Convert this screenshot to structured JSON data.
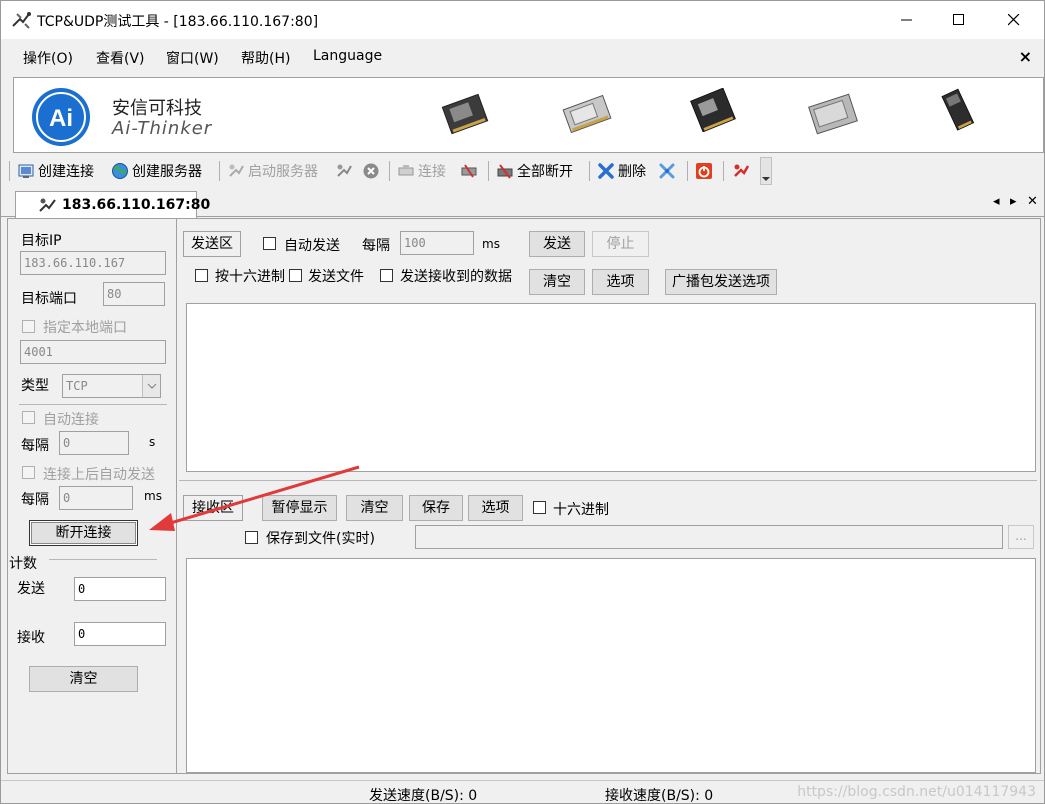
{
  "window": {
    "title": "TCP&UDP测试工具 - [183.66.110.167:80]"
  },
  "menu": {
    "items": [
      "操作(O)",
      "查看(V)",
      "窗口(W)",
      "帮助(H)",
      "Language"
    ],
    "close": "×"
  },
  "banner": {
    "brand_cn": "安信可科技",
    "brand_en": "Ai-Thinker",
    "logo_text": "Ai"
  },
  "toolbar": {
    "create_connection": "创建连接",
    "create_server": "创建服务器",
    "start_server": "启动服务器",
    "connect": "连接",
    "disconnect_all": "全部断开",
    "delete": "删除"
  },
  "tab": {
    "label": "183.66.110.167:80"
  },
  "left_panel": {
    "target_ip_label": "目标IP",
    "target_ip_value": "183.66.110.167",
    "target_port_label": "目标端口",
    "target_port_value": "80",
    "local_port_label": "指定本地端口",
    "local_port_value": "4001",
    "type_label": "类型",
    "type_value": "TCP",
    "auto_connect_label": "自动连接",
    "interval_label": "每隔",
    "interval1_value": "0",
    "interval1_unit": "s",
    "auto_send_after_connect_label": "连接上后自动发送",
    "interval2_value": "0",
    "interval2_unit": "ms",
    "disconnect_button": "断开连接",
    "count_label": "计数",
    "send_label": "发送",
    "send_value": "0",
    "recv_label": "接收",
    "recv_value": "0",
    "clear_button": "清空"
  },
  "send_area": {
    "title": "发送区",
    "auto_send_label": "自动发送",
    "interval_label": "每隔",
    "interval_value": "100",
    "interval_unit": "ms",
    "send_button": "发送",
    "stop_button": "停止",
    "hex_label": "按十六进制",
    "send_file_label": "发送文件",
    "send_received_label": "发送接收到的数据",
    "clear_button": "清空",
    "options_button": "选项",
    "broadcast_button": "广播包发送选项"
  },
  "recv_area": {
    "title": "接收区",
    "pause_button": "暂停显示",
    "clear_button": "清空",
    "save_button": "保存",
    "options_button": "选项",
    "hex_label": "十六进制",
    "save_to_file_label": "保存到文件(实时)",
    "browse_button": "..."
  },
  "status": {
    "send_speed": "发送速度(B/S): 0",
    "recv_speed": "接收速度(B/S): 0",
    "watermark": "https://blog.csdn.net/u014117943"
  },
  "colors": {
    "logo_blue": "#1a6fd0",
    "annotation_arrow": "#e03a3a"
  }
}
